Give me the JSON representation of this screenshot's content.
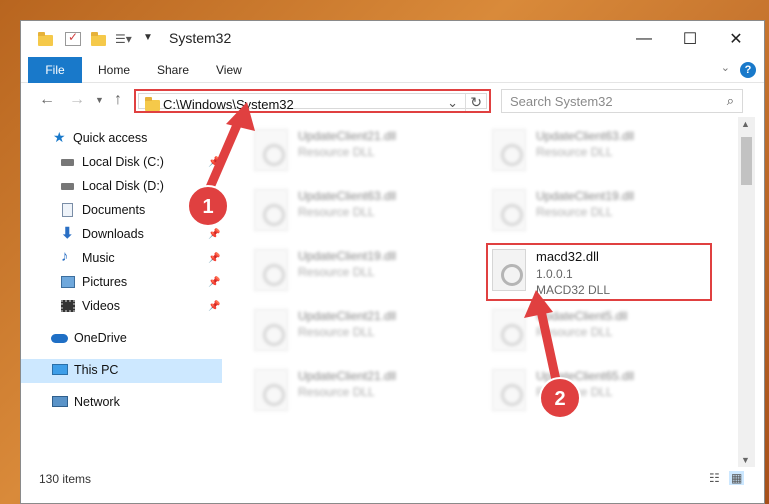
{
  "window": {
    "title": "System32",
    "controls": {
      "minimize": "—",
      "maximize": "☐",
      "close": "✕"
    }
  },
  "ribbon": {
    "file": "File",
    "tabs": [
      "Home",
      "Share",
      "View"
    ],
    "help": "?"
  },
  "address": {
    "path": "C:\\Windows\\System32"
  },
  "search": {
    "placeholder": "Search System32"
  },
  "sidebar": {
    "items": [
      {
        "label": "Quick access",
        "icon": "star-icon",
        "pinned": false
      },
      {
        "label": "Local Disk (C:)",
        "icon": "drive-icon",
        "pinned": true
      },
      {
        "label": "Local Disk (D:)",
        "icon": "drive-icon",
        "pinned": false
      },
      {
        "label": "Documents",
        "icon": "documents-icon",
        "pinned": true
      },
      {
        "label": "Downloads",
        "icon": "download-icon",
        "pinned": true
      },
      {
        "label": "Music",
        "icon": "music-icon",
        "pinned": true
      },
      {
        "label": "Pictures",
        "icon": "pictures-icon",
        "pinned": true
      },
      {
        "label": "Videos",
        "icon": "videos-icon",
        "pinned": true
      },
      {
        "label": "OneDrive",
        "icon": "cloud-icon",
        "pinned": false
      },
      {
        "label": "This PC",
        "icon": "computer-icon",
        "pinned": false,
        "selected": true
      },
      {
        "label": "Network",
        "icon": "network-icon",
        "pinned": false
      }
    ]
  },
  "files": [
    {
      "name": "UpdateClient21.dll",
      "sub": "Resource DLL"
    },
    {
      "name": "UpdateClient63.dll",
      "sub": "Resource DLL"
    },
    {
      "name": "UpdateClient63.dll",
      "sub": "Resource DLL"
    },
    {
      "name": "UpdateClient19.dll",
      "sub": "Resource DLL"
    },
    {
      "name": "UpdateClient19.dll",
      "sub": "Resource DLL"
    },
    {
      "name": "macd32.dll",
      "version": "1.0.0.1",
      "sub": "MACD32 DLL",
      "highlighted": true
    },
    {
      "name": "UpdateClient21.dll",
      "sub": "Resource DLL"
    },
    {
      "name": "UpdateClient5.dll",
      "sub": "Resource DLL"
    },
    {
      "name": "UpdateClient21.dll",
      "sub": "Resource DLL"
    },
    {
      "name": "UpdateClient65.dll",
      "sub": "Resource DLL"
    }
  ],
  "status": {
    "count": "130 items"
  },
  "annotations": {
    "step1": "1",
    "step2": "2",
    "color": "#e04040"
  }
}
